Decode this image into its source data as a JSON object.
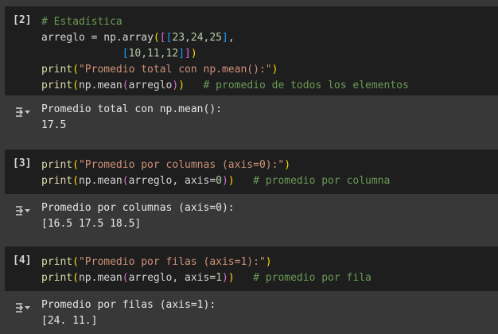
{
  "cells": [
    {
      "prompt": "[2]",
      "comment": "# Estadística",
      "line2_var": "arreglo",
      "line2_eq": " = ",
      "line2_fn": "np.array",
      "line2_nums1": "23,24,25",
      "line3_nums": "10,11,12",
      "print_fn": "print",
      "print_str": "\"Promedio total con np.mean():\"",
      "mean_fn": "np.mean",
      "mean_arg": "arreglo",
      "mean_comment": "# promedio de todos los elementos",
      "output_line1": "Promedio total con np.mean():",
      "output_line2": "17.5"
    },
    {
      "prompt": "[3]",
      "print_fn": "print",
      "print_str": "\"Promedio por columnas (axis=0):\"",
      "mean_fn": "np.mean",
      "mean_arg": "arreglo, axis=",
      "mean_axis": "0",
      "mean_comment": "# promedio por columna",
      "output_line1": "Promedio por columnas (axis=0):",
      "output_line2": "[16.5 17.5 18.5]"
    },
    {
      "prompt": "[4]",
      "print_fn": "print",
      "print_str": "\"Promedio por filas (axis=1):\"",
      "mean_fn": "np.mean",
      "mean_arg": "arreglo, axis=",
      "mean_axis": "1",
      "mean_comment": "# promedio por fila",
      "output_line1": "Promedio por filas (axis=1):",
      "output_line2": "[24. 11.]"
    }
  ],
  "icons": {
    "output_toggle": "output-toggle-icon"
  },
  "colors": {
    "page_bg": "#383838",
    "cell_bg": "#1e1e1e",
    "comment": "#6a9955",
    "function": "#dcdcaa",
    "string": "#ce9178",
    "number": "#b5cea8"
  }
}
